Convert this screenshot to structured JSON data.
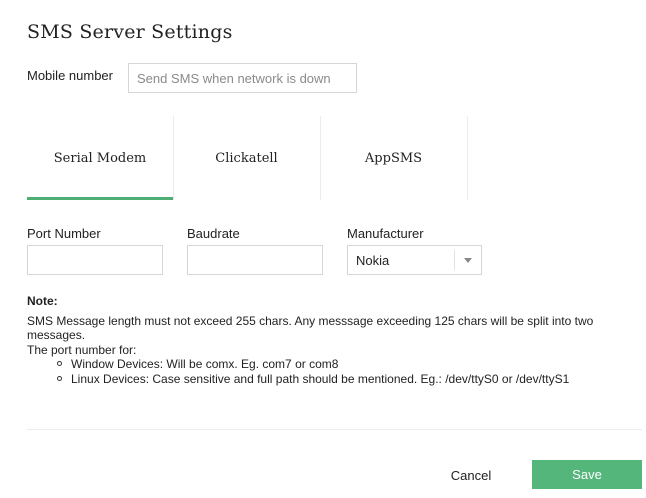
{
  "title": "SMS Server Settings",
  "mobile": {
    "label": "Mobile number",
    "value": "",
    "placeholder": "Send SMS when network is down"
  },
  "tabs": [
    {
      "label": "Serial Modem",
      "active": true
    },
    {
      "label": "Clickatell",
      "active": false
    },
    {
      "label": "AppSMS",
      "active": false
    }
  ],
  "fields": {
    "port_label": "Port Number",
    "port_value": "",
    "baudrate_label": "Baudrate",
    "baudrate_value": "",
    "manufacturer_label": "Manufacturer",
    "manufacturer_value": "Nokia"
  },
  "note": {
    "title": "Note:",
    "line1": "SMS Message length must not exceed 255 chars. Any messsage exceeding 125 chars will be split into two messages.",
    "line2": "The port number for:",
    "bullets": [
      "Window Devices: Will be comx. Eg. com7 or com8",
      "Linux Devices: Case sensitive and full path should be mentioned. Eg.: /dev/ttyS0 or /dev/ttyS1"
    ]
  },
  "footer": {
    "cancel_label": "Cancel",
    "save_label": "Save"
  },
  "colors": {
    "accent": "#4cae72",
    "save_button": "#55b67c"
  },
  "icons": {
    "manufacturer_dropdown": "chevron-down-icon",
    "list_bullet": "circle-bullet-icon"
  }
}
